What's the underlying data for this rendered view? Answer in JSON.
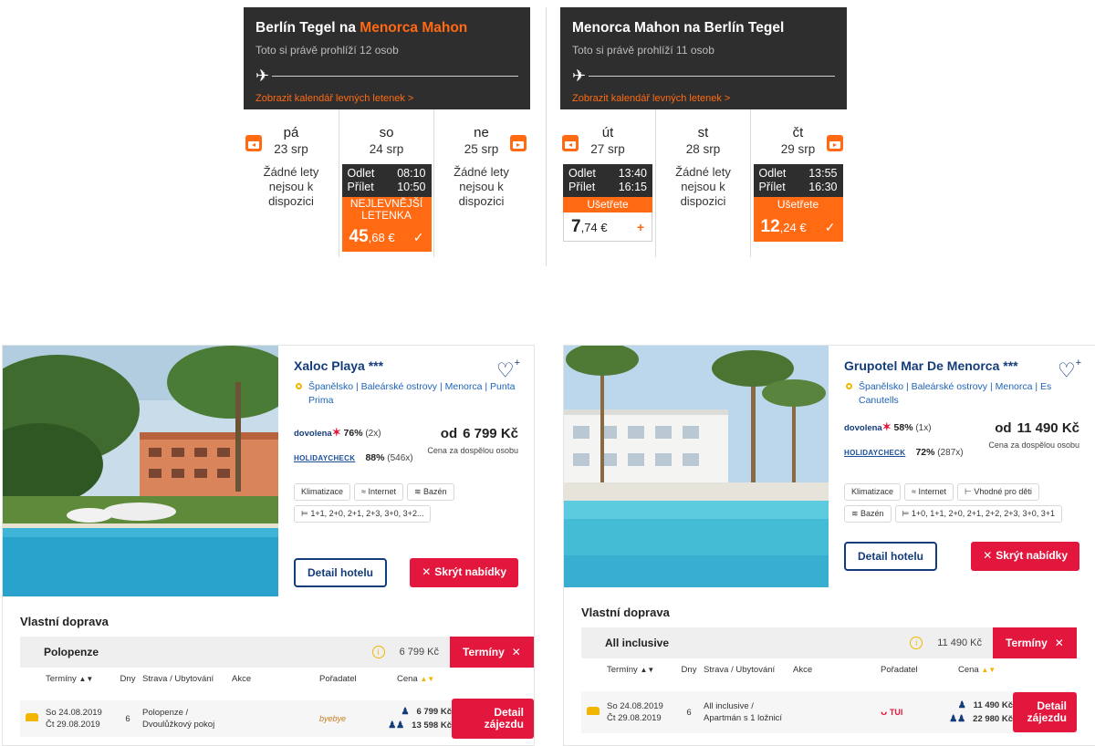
{
  "flights": [
    {
      "title_prefix": "Berlín Tegel na",
      "title_dest": "Menorca Mahon",
      "viewers": "Toto si právě prohlíží 12 osob",
      "calendar_link": "Zobrazit kalendář levných letenek >",
      "days": [
        {
          "name": "pá",
          "date": "23 srp",
          "status": "Žádné lety nejsou k dispozici"
        },
        {
          "name": "so",
          "date": "24 srp",
          "departure_label": "Odlet",
          "departure": "08:10",
          "arrival_label": "Přílet",
          "arrival": "10:50",
          "banner": "NEJLEVNĚJŠÍ LETENKA",
          "price_main": "45",
          "price_rest": ",68 €",
          "selected": true
        },
        {
          "name": "ne",
          "date": "25 srp",
          "status": "Žádné lety nejsou k dispozici"
        }
      ]
    },
    {
      "title_prefix": "Menorca Mahon na Berlín Tegel",
      "title_dest": "",
      "viewers": "Toto si právě prohlíží 11 osob",
      "calendar_link": "Zobrazit kalendář levných letenek >",
      "days": [
        {
          "name": "út",
          "date": "27 srp",
          "departure_label": "Odlet",
          "departure": "13:40",
          "arrival_label": "Přílet",
          "arrival": "16:15",
          "banner": "Ušetřete",
          "price_main": "7",
          "price_rest": ",74 €",
          "selected": false
        },
        {
          "name": "st",
          "date": "28 srp",
          "status": "Žádné lety nejsou k dispozici"
        },
        {
          "name": "čt",
          "date": "29 srp",
          "departure_label": "Odlet",
          "departure": "13:55",
          "arrival_label": "Přílet",
          "arrival": "16:30",
          "banner": "Ušetřete",
          "price_main": "12",
          "price_rest": ",24 €",
          "selected": true
        }
      ]
    }
  ],
  "hotels": [
    {
      "name": "Xaloc Playa ***",
      "location": "Španělsko | Baleárské ostrovy | Menorca | Punta Prima",
      "dovolena_pct": "76%",
      "dovolena_count": "(2x)",
      "holidaycheck_pct": "88%",
      "holidaycheck_count": "(546x)",
      "price_prefix": "od",
      "price": "6 799 Kč",
      "price_note": "Cena za dospělou osobu",
      "tags": [
        "Klimatizace",
        "Internet",
        "Bazén",
        "1+1, 2+0, 2+1, 2+3, 3+0, 3+2..."
      ],
      "detail_button": "Detail hotelu",
      "hide_button": "Skrýt nabídky",
      "transport": "Vlastní doprava",
      "board": "Polopenze",
      "board_price": "6 799 Kč",
      "terms_button": "Termíny",
      "headers": [
        "Termíny",
        "Dny",
        "Strava / Ubytování",
        "Akce",
        "Pořadatel",
        "Cena"
      ],
      "row": {
        "date_from": "So 24.08.2019",
        "date_to": "Čt 29.08.2019",
        "days": "6",
        "meal": "Polopenze /",
        "room": "Dvoulůžkový pokoj",
        "provider": "byebye",
        "price_single": "6 799 Kč",
        "price_double": "13 598 Kč",
        "button": "Detail zájezdu"
      }
    },
    {
      "name": "Grupotel Mar De Menorca ***",
      "location": "Španělsko | Baleárské ostrovy | Menorca | Es Canutells",
      "dovolena_pct": "58%",
      "dovolena_count": "(1x)",
      "holidaycheck_pct": "72%",
      "holidaycheck_count": "(287x)",
      "price_prefix": "od",
      "price": "11 490 Kč",
      "price_note": "Cena za dospělou osobu",
      "tags": [
        "Klimatizace",
        "Internet",
        "Vhodné pro děti",
        "Bazén",
        "1+0, 1+1, 2+0, 2+1, 2+2, 2+3, 3+0, 3+1"
      ],
      "detail_button": "Detail hotelu",
      "hide_button": "Skrýt nabídky",
      "transport": "Vlastní doprava",
      "board": "All inclusive",
      "board_price": "11 490 Kč",
      "terms_button": "Termíny",
      "headers": [
        "Termíny",
        "Dny",
        "Strava / Ubytování",
        "Akce",
        "Pořadatel",
        "Cena"
      ],
      "row": {
        "date_from": "So 24.08.2019",
        "date_to": "Čt 29.08.2019",
        "days": "6",
        "meal": "All inclusive /",
        "room": "Apartmán s 1 ložnicí",
        "provider": "TUI",
        "price_single": "11 490 Kč",
        "price_double": "22 980 Kč",
        "button": "Detail zájezdu"
      }
    }
  ],
  "logos": {
    "dovolena": "dovolena",
    "holidaycheck": "HOLIDAYCHECK"
  },
  "colors": {
    "orange": "#ff6a13",
    "dark": "#2e2e2e",
    "red": "#e3173d",
    "navy": "#143c7a",
    "yellow": "#f2b600"
  }
}
